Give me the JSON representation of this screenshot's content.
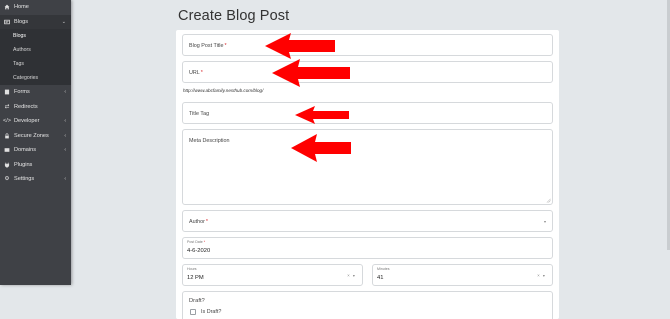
{
  "sidebar": {
    "items": [
      {
        "label": "Home",
        "icon": "home-icon"
      },
      {
        "label": "Blogs",
        "icon": "blog-icon"
      },
      {
        "label": "Forms",
        "icon": "forms-icon"
      },
      {
        "label": "Redirects",
        "icon": "redirect-icon"
      },
      {
        "label": "Developer",
        "icon": "code-icon"
      },
      {
        "label": "Secure Zones",
        "icon": "lock-icon"
      },
      {
        "label": "Domains",
        "icon": "domain-icon"
      },
      {
        "label": "Plugins",
        "icon": "plug-icon"
      },
      {
        "label": "Settings",
        "icon": "gear-icon"
      }
    ],
    "blogs_submenu": [
      "Blogs",
      "Authors",
      "Tags",
      "Categories"
    ]
  },
  "page": {
    "title": "Create Blog Post"
  },
  "form": {
    "blog_post_title": {
      "label": "Blog Post Title",
      "required": "*",
      "value": ""
    },
    "url": {
      "label": "URL",
      "required": "*",
      "value": ""
    },
    "url_hint": "http://www.abcfamily.nesthub.com/blog/",
    "title_tag": {
      "label": "Title Tag",
      "value": ""
    },
    "meta_description": {
      "label": "Meta Description",
      "value": ""
    },
    "author": {
      "label": "Author",
      "required": "*",
      "value": ""
    },
    "post_date": {
      "label": "Post Date",
      "required": "*",
      "value": "4-6-2020"
    },
    "hours": {
      "label": "Hours",
      "value": "12 PM"
    },
    "minutes": {
      "label": "Minutes",
      "value": "41"
    },
    "draft": {
      "heading": "Draft?",
      "checkbox_label": "Is Draft?",
      "checked": false
    }
  },
  "colors": {
    "sidebar_bg": "#3f4146",
    "submenu_bg": "#2f3135",
    "page_bg": "#e3e7ea",
    "required": "#d9262b",
    "annotation_arrow": "#ff0000"
  }
}
